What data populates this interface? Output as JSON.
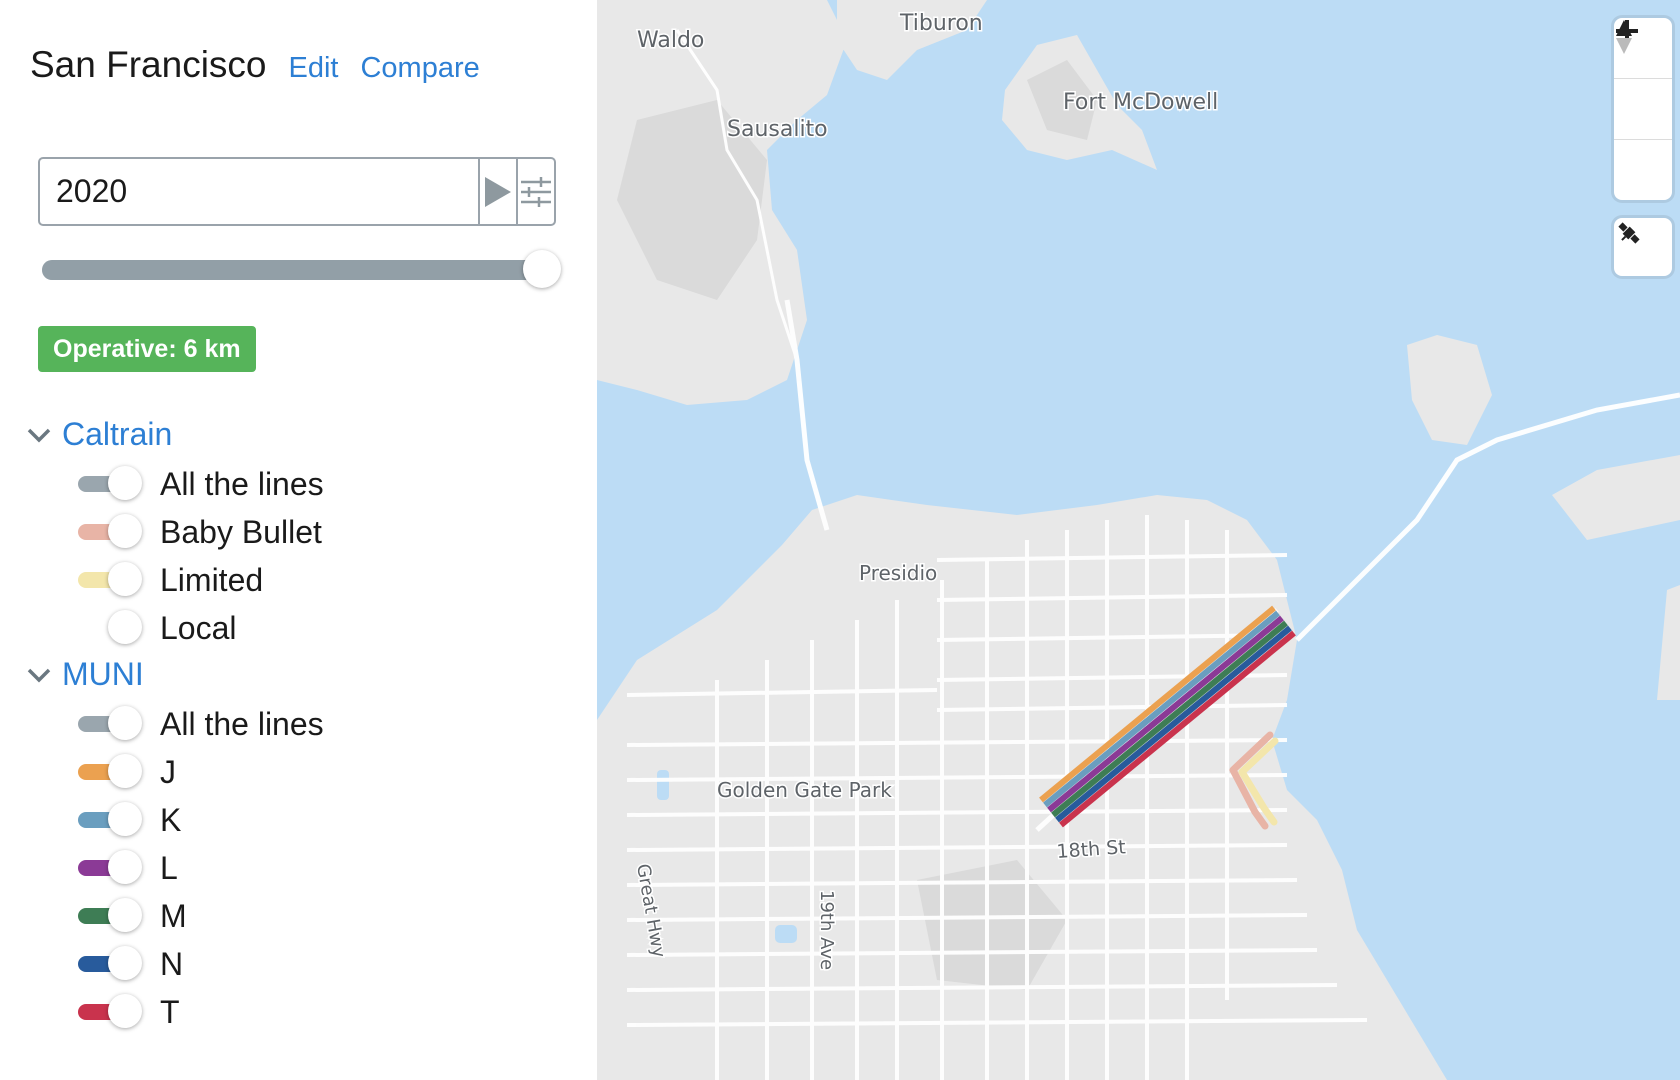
{
  "header": {
    "city": "San Francisco",
    "edit_label": "Edit",
    "compare_label": "Compare"
  },
  "timeline": {
    "year": "2020",
    "play_icon": "play-icon",
    "settings_icon": "sliders-icon",
    "slider_fraction": 1.0
  },
  "badge": {
    "text": "Operative: 6 km",
    "color": "#56b45a"
  },
  "groups": [
    {
      "name": "Caltrain",
      "items": [
        {
          "label": "All the lines",
          "color": "#9aa6ae",
          "on": true
        },
        {
          "label": "Baby Bullet",
          "color": "#e8b4a6",
          "on": true
        },
        {
          "label": "Limited",
          "color": "#f3e6ab",
          "on": true
        },
        {
          "label": "Local",
          "color": "",
          "on": false
        }
      ]
    },
    {
      "name": "MUNI",
      "items": [
        {
          "label": "All the lines",
          "color": "#9aa6ae",
          "on": true
        },
        {
          "label": "J",
          "color": "#eba150",
          "on": true
        },
        {
          "label": "K",
          "color": "#6a9ebf",
          "on": true
        },
        {
          "label": "L",
          "color": "#8b3a96",
          "on": true
        },
        {
          "label": "M",
          "color": "#3e7d55",
          "on": true
        },
        {
          "label": "N",
          "color": "#285b9c",
          "on": true
        },
        {
          "label": "T",
          "color": "#c9334d",
          "on": true
        }
      ]
    }
  ],
  "map": {
    "labels": [
      "Waldo",
      "Tiburon",
      "Fort McDowell",
      "Sausalito",
      "Presidio",
      "Golden Gate Park",
      "18th St",
      "Great Hwy",
      "19th Ave"
    ],
    "controls": {
      "zoom_in_icon": "plus-icon",
      "zoom_out_icon": "minus-icon",
      "compass_icon": "compass-icon",
      "satellite_icon": "satellite-icon"
    }
  }
}
